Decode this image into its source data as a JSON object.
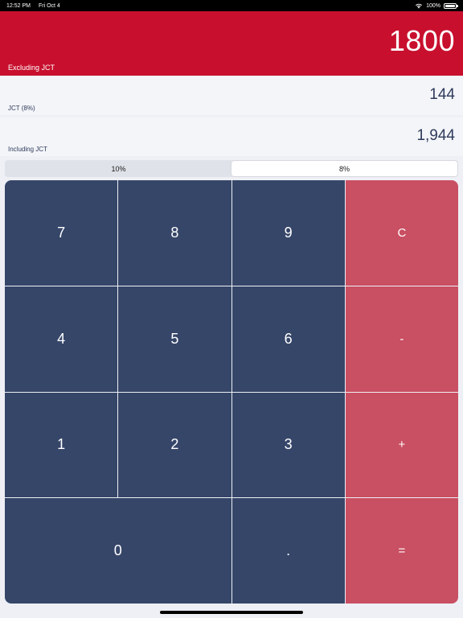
{
  "status_bar": {
    "time": "12:52 PM",
    "date": "Fri Oct 4",
    "battery": "100%"
  },
  "excluding": {
    "value": "1800",
    "label": "Excluding JCT"
  },
  "jct": {
    "value": "144",
    "label": "JCT (8%)"
  },
  "including": {
    "value": "1,944",
    "label": "Including JCT"
  },
  "rate_options": [
    {
      "label": "10%",
      "selected": false
    },
    {
      "label": "8%",
      "selected": true
    }
  ],
  "keypad": {
    "k7": "7",
    "k8": "8",
    "k9": "9",
    "clear": "C",
    "k4": "4",
    "k5": "5",
    "k6": "6",
    "minus": "-",
    "k1": "1",
    "k2": "2",
    "k3": "3",
    "plus": "+",
    "k0": "0",
    "dot": ".",
    "equals": "="
  },
  "colors": {
    "header_red": "#c8102e",
    "key_navy": "#364669",
    "key_rose": "#c94f62"
  }
}
